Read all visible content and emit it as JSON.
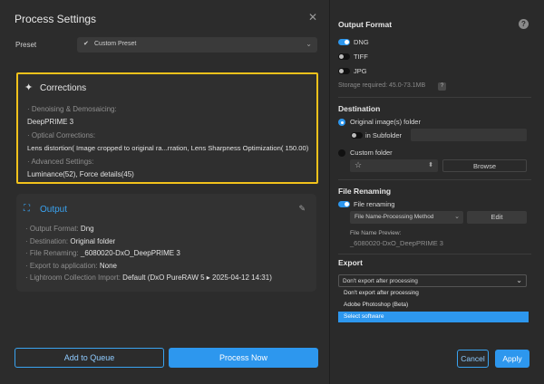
{
  "dialog": {
    "title": "Process Settings",
    "close_icon": "✕"
  },
  "preset": {
    "label": "Preset",
    "value": "Custom Preset"
  },
  "corrections": {
    "title": "Corrections",
    "rows": [
      {
        "label": "· Denoising & Demosaicing:",
        "value": "DeepPRIME 3"
      },
      {
        "label": "· Optical Corrections:",
        "value": "Lens distortion( Image cropped to original ra...rration, Lens Sharpness Optimization( 150.00)"
      },
      {
        "label": "· Advanced Settings:",
        "value": "Luminance(52), Force details(45)"
      }
    ]
  },
  "output": {
    "title": "Output",
    "rows": [
      {
        "label": "· Output Format:",
        "value": "Dng"
      },
      {
        "label": "· Destination:",
        "value": "Original folder"
      },
      {
        "label": "· File Renaming:",
        "value": "_6080020-DxO_DeepPRIME 3"
      },
      {
        "label": "· Export to application:",
        "value": "None"
      },
      {
        "label": "· Lightroom Collection Import:",
        "value": "Default (DxO PureRAW 5 ▸ 2025-04-12 14:31)"
      }
    ]
  },
  "buttons": {
    "add_to_queue": "Add to Queue",
    "process_now": "Process Now",
    "cancel": "Cancel",
    "apply": "Apply"
  },
  "output_format": {
    "title": "Output Format",
    "help": "?",
    "options": [
      {
        "label": "DNG",
        "on": true
      },
      {
        "label": "TIFF",
        "on": false
      },
      {
        "label": "JPG",
        "on": false
      }
    ],
    "storage": "Storage required: 45.0-73.1MB",
    "storage_help": "?"
  },
  "destination": {
    "title": "Destination",
    "original_folder": "Original image(s) folder",
    "in_subfolder": "in Subfolder",
    "custom_folder": "Custom folder",
    "browse": "Browse",
    "star": "☆"
  },
  "file_renaming": {
    "title": "File Renaming",
    "toggle_label": "File renaming",
    "method": "File Name-Processing Method",
    "edit": "Edit",
    "preview_label": "File Name Preview:",
    "preview_value": "_6080020-DxO_DeepPRIME 3"
  },
  "export": {
    "title": "Export",
    "selected": "Don't export after processing",
    "options": [
      "Don't export after processing",
      "Adobe Photoshop (Beta)",
      "Select software"
    ]
  },
  "colors": {
    "accent": "#2d97ee",
    "highlight_border": "#f2c21b"
  }
}
